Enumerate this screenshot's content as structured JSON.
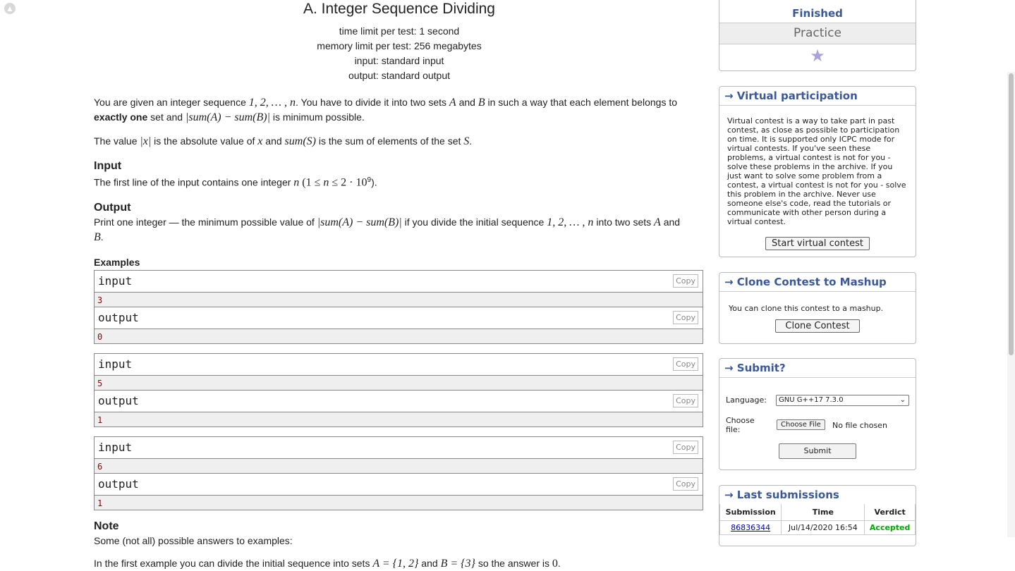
{
  "problem": {
    "title": "A. Integer Sequence Dividing",
    "time_limit": "time limit per test: 1 second",
    "memory_limit": "memory limit per test: 256 megabytes",
    "input": "input: standard input",
    "output": "output: standard output",
    "statement_1a": "You are given an integer sequence ",
    "seq": "1, 2, … , n",
    "statement_1b": ". You have to divide it into two sets ",
    "set_a": "A",
    "statement_1c": " and ",
    "set_b": "B",
    "statement_1d": " in such a way that each element belongs to",
    "statement_2a": "exactly one",
    "statement_2b": " set and ",
    "abs_expr": "|sum(A) − sum(B)|",
    "statement_2c": " is minimum possible.",
    "value_line_a": "The value ",
    "abs_x": "|x|",
    "value_line_b": " is the absolute value of ",
    "x": "x",
    "value_line_c": " and ",
    "sum_s": "sum(S)",
    "value_line_d": " is the sum of elements of the set ",
    "s": "S",
    "value_line_e": ".",
    "input_title": "Input",
    "input_text_a": "The first line of the input contains one integer ",
    "n": "n",
    "input_text_b": " (1 ≤ ",
    "input_text_c": " ≤ 2 · 10",
    "exp": "9",
    "input_text_d": ").",
    "output_title": "Output",
    "output_text_a": "Print one integer — the minimum possible value of ",
    "output_text_b": " if you divide the initial sequence ",
    "output_text_c": " into two sets ",
    "output_text_d": " and",
    "output_text_e": ".",
    "examples_title": "Examples",
    "note_title": "Note",
    "note_text": "Some (not all) possible answers to examples:",
    "note_example_a": "In the first example you can divide the initial sequence into sets ",
    "note_set_a": "A = {1, 2}",
    "note_example_b": " and ",
    "note_set_b": "B = {3}",
    "note_example_c": " so the answer is ",
    "zero": "0",
    "note_example_d": "."
  },
  "examples": [
    {
      "input_label": "input",
      "input_value": "3",
      "output_label": "output",
      "output_value": "0"
    },
    {
      "input_label": "input",
      "input_value": "5",
      "output_label": "output",
      "output_value": "1"
    },
    {
      "input_label": "input",
      "input_value": "6",
      "output_label": "output",
      "output_value": "1"
    }
  ],
  "copy_label": "Copy",
  "sidebar": {
    "status": "Finished",
    "mode": "Practice",
    "virtual": {
      "title": "→ Virtual participation",
      "text": "Virtual contest is a way to take part in past contest, as close as possible to participation on time. It is supported only ICPC mode for virtual contests. If you've seen these problems, a virtual contest is not for you - solve these problems in the archive. If you just want to solve some problem from a contest, a virtual contest is not for you - solve this problem in the archive. Never use someone else's code, read the tutorials or communicate with other person during a virtual contest.",
      "button": "Start virtual contest"
    },
    "clone": {
      "title": "→ Clone Contest to Mashup",
      "text": "You can clone this contest to a mashup.",
      "button": "Clone Contest"
    },
    "submit": {
      "title": "→ Submit?",
      "language_label": "Language:",
      "language_value": "GNU G++17 7.3.0",
      "file_label": "Choose file:",
      "file_button": "Choose File",
      "file_status": "No file chosen",
      "submit_button": "Submit"
    },
    "last": {
      "title": "→ Last submissions",
      "headers": [
        "Submission",
        "Time",
        "Verdict"
      ],
      "row": {
        "id": "86836344",
        "time": "Jul/14/2020 16:54",
        "verdict": "Accepted"
      }
    }
  },
  "colors": {
    "accent": "#3b5998",
    "accepted": "#0a0",
    "example_value": "#990000"
  }
}
